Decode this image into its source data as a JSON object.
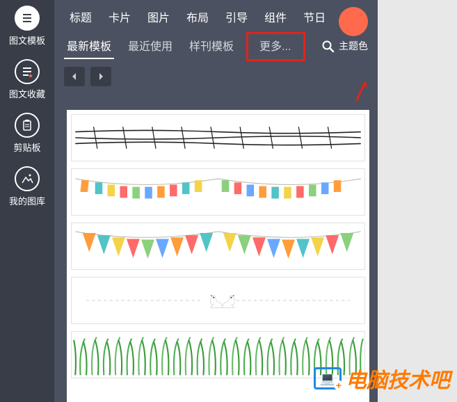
{
  "leftbar": {
    "items": [
      {
        "label": "图文模板",
        "icon": "lines"
      },
      {
        "label": "图文收藏",
        "icon": "lines-star"
      },
      {
        "label": "剪贴板",
        "icon": "clipboard"
      },
      {
        "label": "我的图库",
        "icon": "image"
      }
    ]
  },
  "topcats": {
    "items": [
      "标题",
      "卡片",
      "图片",
      "布局",
      "引导",
      "组件",
      "节日"
    ]
  },
  "subtabs": {
    "items": [
      {
        "label": "最新模板",
        "active": true
      },
      {
        "label": "最近使用"
      },
      {
        "label": "样刊模板"
      },
      {
        "label": "更多...",
        "highlight": true
      }
    ]
  },
  "theme": {
    "label": "主题色",
    "color": "#ff6a4d"
  },
  "search": {
    "icon": "search"
  },
  "nav": {
    "prev": "◄",
    "next": "►"
  },
  "templates": [
    {
      "kind": "barbed-wire"
    },
    {
      "kind": "bunting-flags"
    },
    {
      "kind": "pennant-triangles"
    },
    {
      "kind": "swan-divider"
    },
    {
      "kind": "grass"
    }
  ],
  "watermark": {
    "text": "电脑技术吧"
  }
}
